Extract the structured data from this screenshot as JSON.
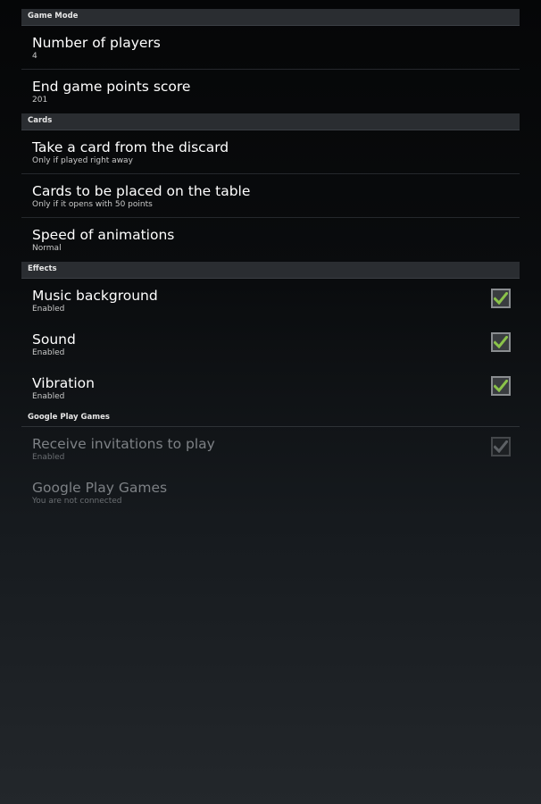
{
  "sections": [
    {
      "header": "Game Mode",
      "items": [
        {
          "title": "Number of players",
          "summary": "4"
        },
        {
          "title": "End game points score",
          "summary": "201"
        }
      ]
    },
    {
      "header": "Cards",
      "items": [
        {
          "title": "Take a card from the discard",
          "summary": "Only if played right away"
        },
        {
          "title": "Cards to be placed on the table",
          "summary": "Only if it opens with 50 points"
        },
        {
          "title": "Speed of animations",
          "summary": "Normal"
        }
      ]
    },
    {
      "header": "Effects",
      "items": [
        {
          "title": "Music background",
          "summary": "Enabled",
          "checked": true
        },
        {
          "title": "Sound",
          "summary": "Enabled",
          "checked": true
        },
        {
          "title": "Vibration",
          "summary": "Enabled",
          "checked": true
        }
      ]
    },
    {
      "header": "Google Play Games",
      "items": [
        {
          "title": "Receive invitations to play",
          "summary": "Enabled",
          "checked": true,
          "enabled": false
        },
        {
          "title": "Google Play Games",
          "summary": "You are not connected",
          "enabled": false
        }
      ]
    }
  ],
  "colors": {
    "check_active": "#8bc34a",
    "check_disabled": "#5d6165"
  },
  "icons": {
    "checkbox": "check-mark-icon"
  }
}
